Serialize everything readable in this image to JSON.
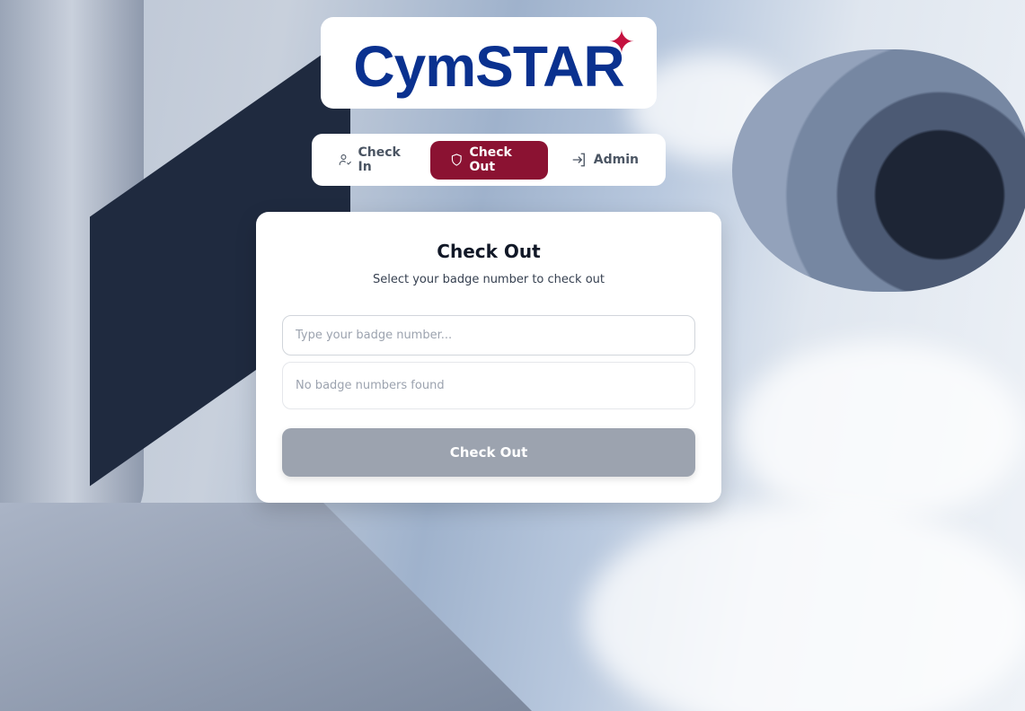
{
  "logo": {
    "text": "CymSTAR"
  },
  "nav": {
    "tabs": [
      {
        "label": "Check In",
        "icon": "user-check-icon"
      },
      {
        "label": "Check Out",
        "icon": "shield-icon",
        "active": true
      },
      {
        "label": "Admin",
        "icon": "log-in-icon"
      }
    ]
  },
  "card": {
    "title": "Check Out",
    "subtitle": "Select your badge number to check out",
    "badge_input": {
      "value": "",
      "placeholder": "Type your badge number..."
    },
    "empty_message": "No badge numbers found",
    "submit_label": "Check Out",
    "submit_disabled": true
  },
  "colors": {
    "brand_blue": "#0a318f",
    "accent": "#8b1232",
    "star": "#c4113f",
    "disabled_button": "#9ca3af"
  }
}
